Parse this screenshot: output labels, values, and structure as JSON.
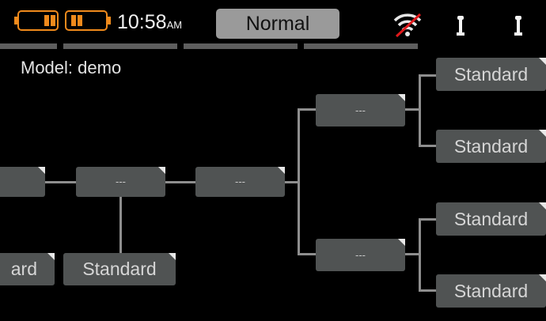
{
  "status_bar": {
    "time": "10:58",
    "time_suffix": "AM",
    "mode": "Normal"
  },
  "model_label": "Model: demo",
  "colors": {
    "battery": "#f08a1c",
    "box": "#505353",
    "line": "#8e8e8e",
    "mode_bg": "#9a9a9a"
  },
  "icons": [
    "battery-icon",
    "battery-icon",
    "no-signal-icon",
    "switch-icon",
    "switch-icon"
  ],
  "blocks": {
    "left_partial_label": "",
    "left_bottom_partial_label": "ard",
    "mix1_label": "---",
    "mix1_child_label": "Standard",
    "mix2_label": "---",
    "mix_top_label": "---",
    "mix_bottom_label": "---",
    "out1_label": "Standard",
    "out2_label": "Standard",
    "out3_label": "Standard",
    "out4_label": "Standard"
  }
}
